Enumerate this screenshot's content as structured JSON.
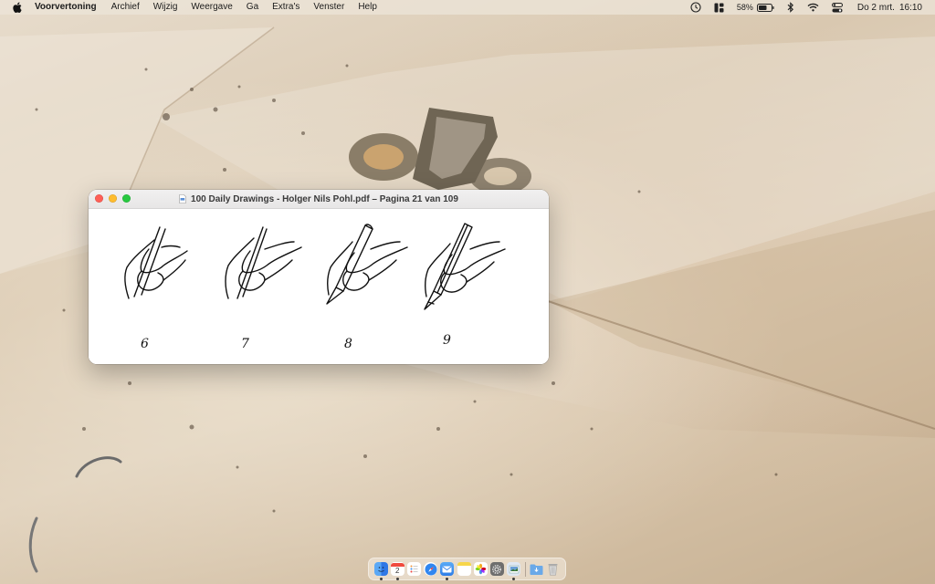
{
  "menubar": {
    "apple_icon": "apple-logo-icon",
    "app_name": "Voorvertoning",
    "items": [
      "Archief",
      "Wijzig",
      "Weergave",
      "Ga",
      "Extra's",
      "Venster",
      "Help"
    ],
    "status": {
      "battery_percent": "58%",
      "date": "Do 2 mrt.",
      "time": "16:10"
    }
  },
  "window": {
    "title": "100 Daily Drawings - Holger Nils Pohl.pdf – Pagina 21 van 109",
    "page": {
      "drawings": [
        {
          "number": "6"
        },
        {
          "number": "7"
        },
        {
          "number": "8"
        },
        {
          "number": "9"
        }
      ]
    }
  },
  "dock": {
    "items": [
      {
        "name": "finder-icon",
        "color": "#3d8ef0"
      },
      {
        "name": "calendar-icon",
        "color": "#ffffff",
        "label": "2"
      },
      {
        "name": "reminders-icon",
        "color": "#ffffff"
      },
      {
        "name": "safari-icon",
        "color": "#2f86f0"
      },
      {
        "name": "mail-icon",
        "color": "#3f8fef"
      },
      {
        "name": "notes-icon",
        "color": "#f7d64a"
      },
      {
        "name": "photos-icon",
        "color": "#f1f1f1"
      },
      {
        "name": "system-settings-icon",
        "color": "#8a8a8a"
      },
      {
        "name": "preview-icon",
        "color": "#dfe8f3"
      },
      {
        "name": "downloads-folder-icon",
        "color": "#6aa9e8"
      },
      {
        "name": "trash-icon",
        "color": "#c9c9c9"
      }
    ]
  }
}
